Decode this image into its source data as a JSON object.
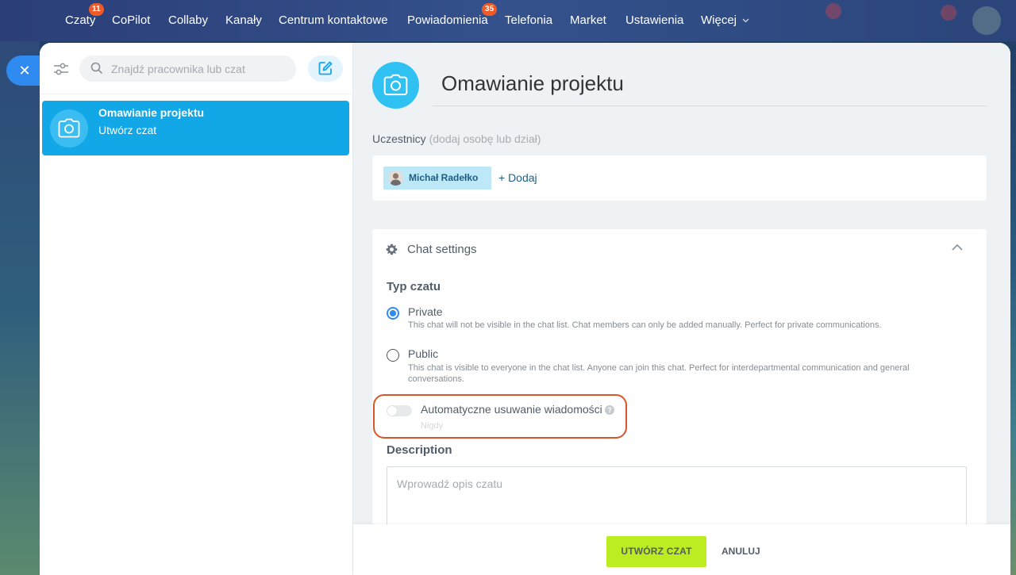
{
  "topnav": {
    "items": [
      {
        "label": "Czaty",
        "badge": "11"
      },
      {
        "label": "CoPilot"
      },
      {
        "label": "Collaby"
      },
      {
        "label": "Kanały"
      },
      {
        "label": "Centrum kontaktowe"
      },
      {
        "label": "Powiadomienia",
        "badge": "35"
      },
      {
        "label": "Telefonia"
      },
      {
        "label": "Market"
      },
      {
        "label": "Ustawienia"
      },
      {
        "label": "Więcej"
      }
    ]
  },
  "sidebar": {
    "search_placeholder": "Znajdź pracownika lub czat",
    "chat_item": {
      "title": "Omawianie projektu",
      "subtitle": "Utwórz czat"
    }
  },
  "main": {
    "chat_title": "Omawianie projektu",
    "members_label": "Uczestnicy",
    "members_hint": "(dodaj osobę lub dział)",
    "member_name": "Michał Radełko",
    "add_label": "+ Dodaj",
    "settings": {
      "title": "Chat settings",
      "type_label": "Typ czatu",
      "private_title": "Private",
      "private_desc": "This chat will not be visible in the chat list. Chat members can only be added manually. Perfect for private communications.",
      "public_title": "Public",
      "public_desc": "This chat is visible to everyone in the chat list. Anyone can join this chat. Perfect for interdepartmental communication and general conversations.",
      "auto_delete_label": "Automatyczne usuwanie wiadomości",
      "auto_delete_value": "Nigdy",
      "description_label": "Description",
      "description_placeholder": "Wprowadź opis czatu"
    },
    "footer": {
      "create_label": "UTWÓRZ CZAT",
      "cancel_label": "ANULUJ"
    }
  },
  "colors": {
    "accent_blue": "#12a7e6",
    "create_green": "#bbed21",
    "badge_orange": "#ee5b29",
    "highlight_red": "#d8572a"
  }
}
